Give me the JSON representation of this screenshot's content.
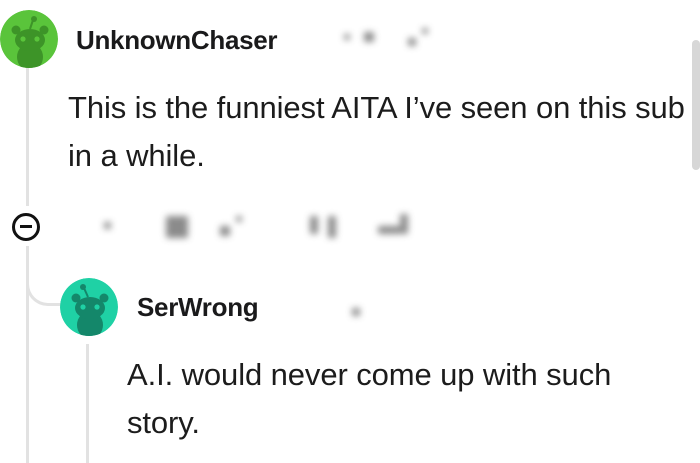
{
  "comments": [
    {
      "username": "UnknownChaser",
      "body": "This is the funniest AITA I’ve seen on this sub in a while.",
      "avatar_color": "#5ac43b",
      "avatar_icon": "snoo-avatar-icon"
    },
    {
      "username": "SerWrong",
      "body": "A.I. would never come up with such story.",
      "avatar_color": "#1fd1a5",
      "avatar_icon": "snoo-avatar-icon"
    }
  ],
  "icons": {
    "collapse": "collapse-minus-icon"
  },
  "colors": {
    "thread_line": "#e2e2e2",
    "text": "#1a1a1b"
  }
}
